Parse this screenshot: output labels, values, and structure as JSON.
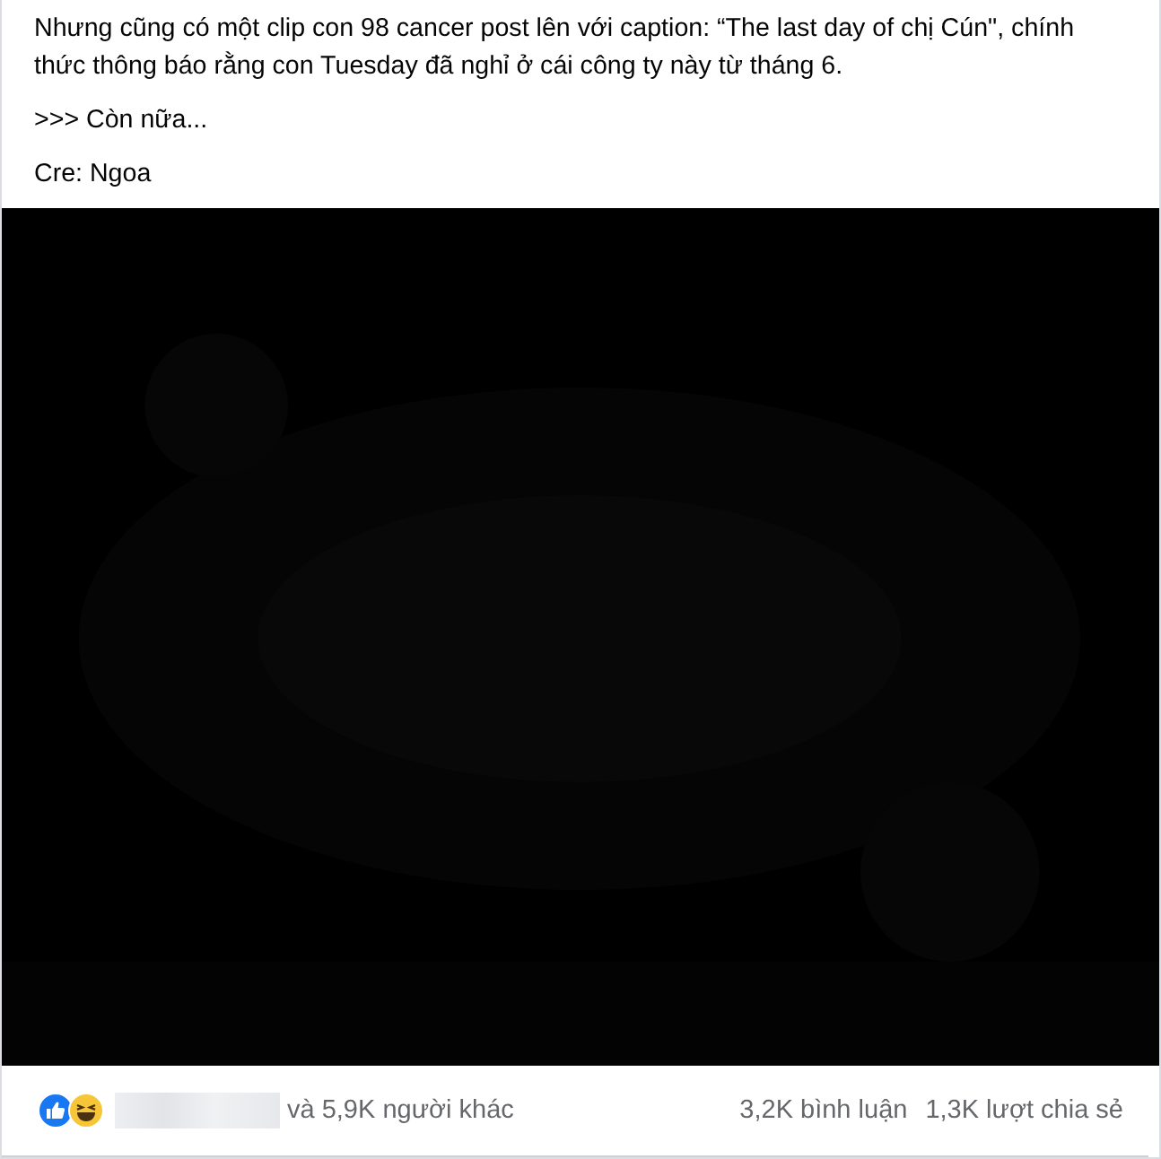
{
  "post": {
    "paragraphs": [
      "Nhưng cũng có một clip con 98 cancer post lên với caption: “The last day of chị Cún\", chính thức thông báo rằng con Tuesday đã nghỉ ở cái công ty này từ tháng 6.",
      ">>> Còn nữa...",
      "Cre: Ngoa"
    ]
  },
  "footer": {
    "reactions_text": "và 5,9K người khác",
    "comments": "3,2K bình luận",
    "shares": "1,3K lượt chia sẻ"
  }
}
